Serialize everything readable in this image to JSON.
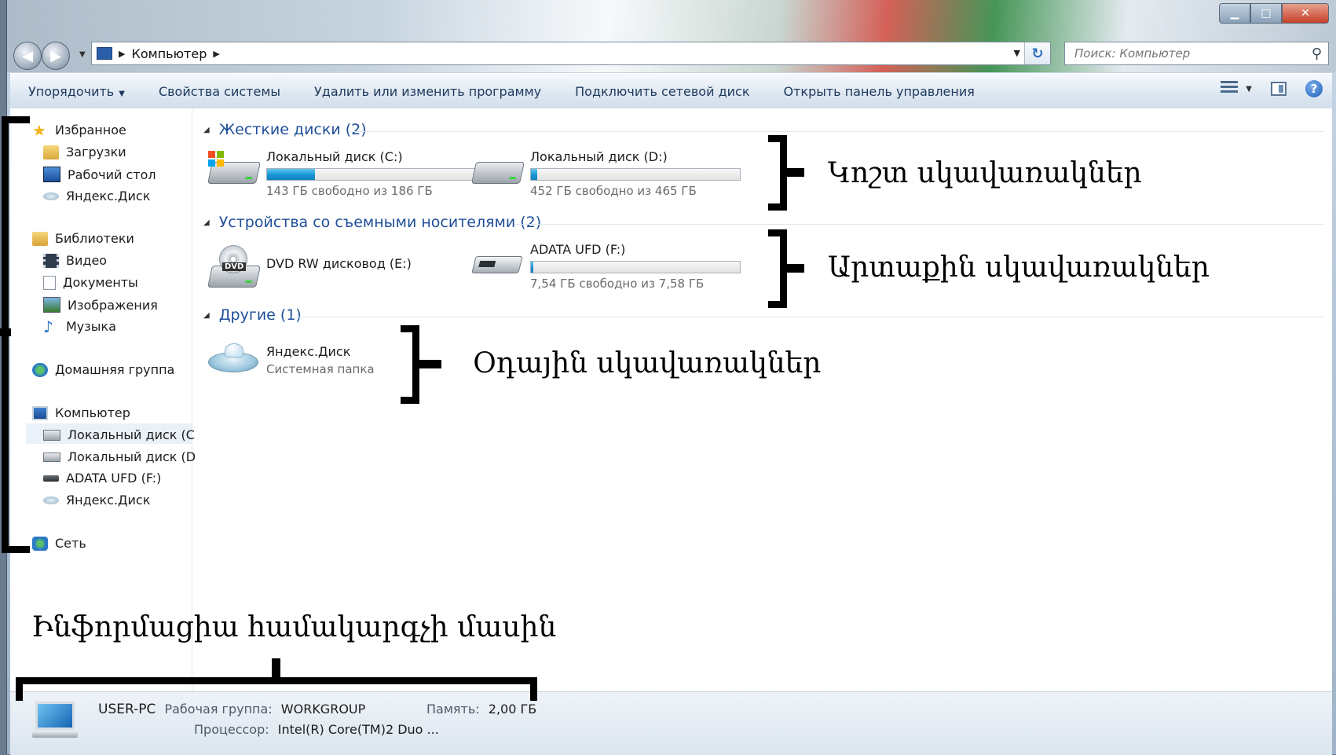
{
  "window": {
    "controls": {
      "minimize": "▁",
      "maximize": "□",
      "close": "✕"
    }
  },
  "nav": {
    "back": "◀",
    "forward": "▶",
    "address_crumb": "Компьютер",
    "search_placeholder": "Поиск: Компьютер"
  },
  "commands": {
    "organize": "Упорядочить",
    "system_properties": "Свойства системы",
    "uninstall": "Удалить или изменить программу",
    "map_drive": "Подключить сетевой диск",
    "control_panel": "Открыть панель управления"
  },
  "sidebar": {
    "favorites": "Избранное",
    "downloads": "Загрузки",
    "desktop": "Рабочий стол",
    "yadisk_fav": "Яндекс.Диск",
    "libraries": "Библиотеки",
    "video": "Видео",
    "documents": "Документы",
    "pictures": "Изображения",
    "music": "Музыка",
    "homegroup": "Домашняя группа",
    "computer": "Компьютер",
    "drive_c": "Локальный диск (C",
    "drive_d": "Локальный диск (D",
    "drive_f": "ADATA UFD (F:)",
    "yadisk_comp": "Яндекс.Диск",
    "network": "Сеть"
  },
  "sections": {
    "hard_disks": "Жесткие диски (2)",
    "removable": "Устройства со съемными носителями (2)",
    "other": "Другие (1)"
  },
  "drives": {
    "c": {
      "name": "Локальный диск (C:)",
      "free": "143 ГБ свободно из 186 ГБ",
      "used_fraction": 0.23
    },
    "d": {
      "name": "Локальный диск (D:)",
      "free": "452 ГБ свободно из 465 ГБ",
      "used_fraction": 0.03
    },
    "e": {
      "name": "DVD RW дисковод (E:)"
    },
    "f": {
      "name": "ADATA UFD (F:)",
      "free": "7,54 ГБ свободно из 7,58 ГБ",
      "used_fraction": 0.01
    },
    "yadisk": {
      "name": "Яндекс.Диск",
      "subtitle": "Системная папка"
    }
  },
  "annotations": {
    "hard": "Կոշտ սկավառակներ",
    "external": "Արտաքին սկավառակներ",
    "cloud": "Օդային սկավառակներ",
    "info": "Ինֆորմացիա համակարգչի մասին"
  },
  "details": {
    "pc_name": "USER-PC",
    "workgroup_label": "Рабочая группа:",
    "workgroup_value": "WORKGROUP",
    "memory_label": "Память:",
    "memory_value": "2,00 ГБ",
    "cpu_label": "Процессор:",
    "cpu_value": "Intel(R) Core(TM)2 Duo ..."
  },
  "colors": {
    "link_blue": "#1f4f9a",
    "bar_fill": "#1a95d3"
  }
}
